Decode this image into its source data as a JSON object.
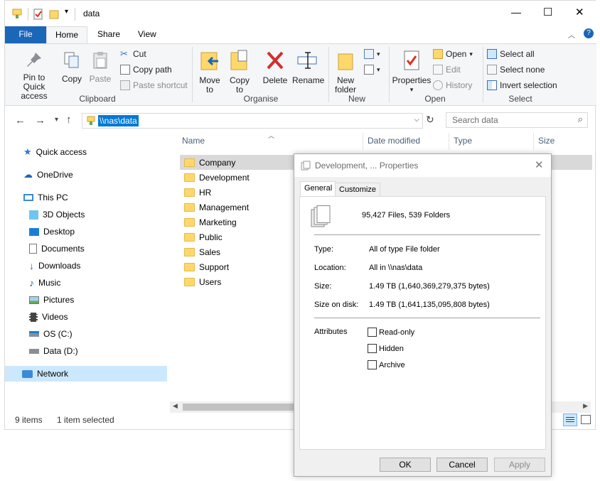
{
  "window": {
    "title": "data",
    "controls": {
      "minimize": "—",
      "maximize": "☐",
      "close": "✕"
    }
  },
  "ribbon": {
    "tabs": [
      "File",
      "Home",
      "Share",
      "View"
    ],
    "clipboard": {
      "pin": "Pin to Quick access",
      "copy": "Copy",
      "paste": "Paste",
      "cut": "Cut",
      "copy_path": "Copy path",
      "paste_shortcut": "Paste shortcut",
      "label": "Clipboard"
    },
    "organise": {
      "move_to": "Move to",
      "copy_to": "Copy to",
      "delete": "Delete",
      "rename": "Rename",
      "label": "Organise"
    },
    "new": {
      "new_folder": "New folder",
      "label": "New"
    },
    "open": {
      "properties": "Properties",
      "open": "Open",
      "edit": "Edit",
      "history": "History",
      "label": "Open"
    },
    "select": {
      "select_all": "Select all",
      "select_none": "Select none",
      "invert": "Invert selection",
      "label": "Select"
    }
  },
  "address": {
    "path": "\\\\nas\\data",
    "search_placeholder": "Search data"
  },
  "nav": [
    "Quick access",
    "OneDrive",
    "This PC",
    "3D Objects",
    "Desktop",
    "Documents",
    "Downloads",
    "Music",
    "Pictures",
    "Videos",
    "OS (C:)",
    "Data (D:)",
    "Network"
  ],
  "columns": {
    "name": "Name",
    "date": "Date modified",
    "type": "Type",
    "size": "Size"
  },
  "files": [
    "Company",
    "Development",
    "HR",
    "Management",
    "Marketing",
    "Public",
    "Sales",
    "Support",
    "Users"
  ],
  "status": {
    "items": "9 items",
    "selected": "1 item selected"
  },
  "dialog": {
    "title": "Development, ... Properties",
    "tabs": [
      "General",
      "Customize"
    ],
    "summary": "95,427 Files, 539 Folders",
    "type_label": "Type:",
    "type_value": "All of type File folder",
    "location_label": "Location:",
    "location_value": "All in \\\\nas\\data",
    "size_label": "Size:",
    "size_value": "1.49 TB (1,640,369,279,375 bytes)",
    "disk_label": "Size on disk:",
    "disk_value": "1.49 TB (1,641,135,095,808 bytes)",
    "attributes_label": "Attributes",
    "attributes": [
      "Read-only",
      "Hidden",
      "Archive"
    ],
    "buttons": {
      "ok": "OK",
      "cancel": "Cancel",
      "apply": "Apply"
    }
  },
  "colors": {
    "accent": "#1a66b8",
    "selection": "#cce8ff",
    "folder": "#ffd86b"
  }
}
